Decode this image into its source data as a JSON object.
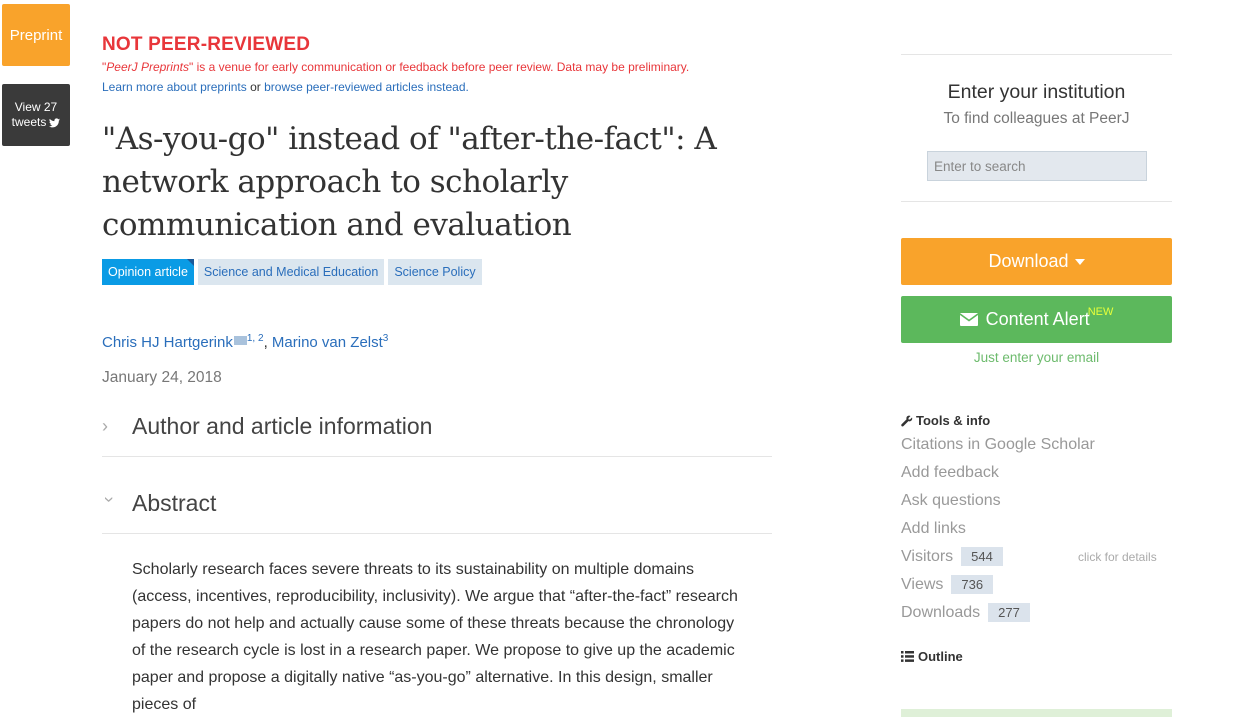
{
  "badges": {
    "preprint": "Preprint",
    "tweets_line1": "View 27",
    "tweets_line2": "tweets"
  },
  "notice": {
    "title": "NOT PEER-REVIEWED",
    "quote_open": "\"",
    "brand": "PeerJ Preprints",
    "desc_rest": "\" is a venue for early communication or feedback before peer review. Data may be preliminary.",
    "learn_more": "Learn more about preprints",
    "or": " or ",
    "browse": "browse peer-reviewed articles instead."
  },
  "article": {
    "title": "\"As-you-go\" instead of \"after-the-fact\": A network approach to scholarly communication and evaluation",
    "tags": [
      "Opinion article",
      "Science and Medical Education",
      "Science Policy"
    ],
    "authors": [
      {
        "name": "Chris HJ Hartgerink",
        "sup": "1, 2"
      },
      {
        "name": "Marino van Zelst",
        "sup": "3"
      }
    ],
    "author_sep": ", ",
    "date": "January 24, 2018",
    "sections": {
      "author_info": "Author and article information",
      "abstract": "Abstract"
    },
    "abstract": "Scholarly research faces severe threats to its sustainability on multiple domains (access, incentives, reproducibility, inclusivity). We argue that “after-the-fact” research papers do not help and actually cause some of these threats because the chronology of the research cycle is lost in a research paper. We propose to give up the academic paper and propose a digitally native “as-you-go” alternative. In this design, smaller pieces of"
  },
  "sidebar": {
    "institution": {
      "title": "Enter your institution",
      "subtitle": "To find colleagues at PeerJ",
      "placeholder": "Enter to search"
    },
    "download_label": "Download",
    "alert_label": "Content Alert",
    "alert_badge": "NEW",
    "email_note": "Just enter your email",
    "tools_heading": "Tools & info",
    "tools_links": [
      "Citations in Google Scholar",
      "Add feedback",
      "Ask questions",
      "Add links"
    ],
    "stats": [
      {
        "label": "Visitors",
        "value": "544"
      },
      {
        "label": "Views",
        "value": "736"
      },
      {
        "label": "Downloads",
        "value": "277"
      }
    ],
    "click_details": "click for details",
    "outline_heading": "Outline"
  },
  "colors": {
    "orange": "#f9a32b",
    "green": "#5cb85c",
    "red": "#e8363a",
    "link": "#2a6ebb",
    "tag_primary": "#0a9be5"
  }
}
